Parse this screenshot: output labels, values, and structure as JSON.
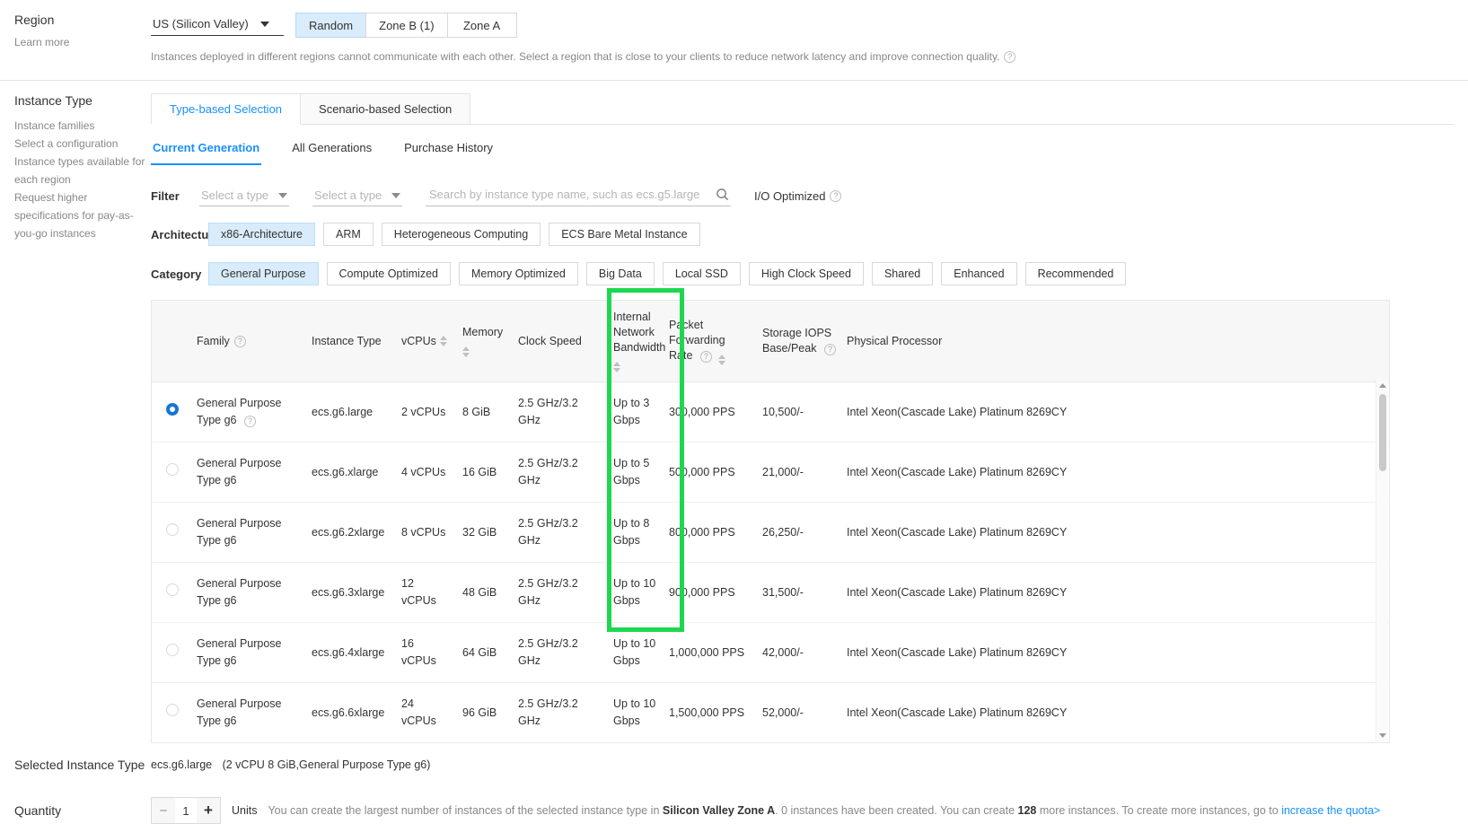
{
  "region": {
    "label": "Region",
    "learn_more": "Learn more",
    "selected": "US (Silicon Valley)",
    "zones": [
      {
        "label": "Random",
        "active": true
      },
      {
        "label": "Zone B (1)",
        "active": false
      },
      {
        "label": "Zone A",
        "active": false
      }
    ],
    "hint": "Instances deployed in different regions cannot communicate with each other. Select a region that is close to your clients to reduce network latency and improve connection quality."
  },
  "sidebar": {
    "title": "Instance Type",
    "links": [
      "Instance families",
      "Select a configuration",
      "Instance types available for each region",
      "Request higher specifications for pay-as-you-go instances"
    ]
  },
  "outer_tabs": [
    {
      "label": "Type-based Selection",
      "active": true
    },
    {
      "label": "Scenario-based Selection",
      "active": false
    }
  ],
  "inner_tabs": [
    {
      "label": "Current Generation",
      "active": true
    },
    {
      "label": "All Generations",
      "active": false
    },
    {
      "label": "Purchase History",
      "active": false
    }
  ],
  "filter": {
    "key": "Filter",
    "select_1": "Select a type",
    "select_2": "Select a type",
    "search_placeholder": "Search by instance type name, such as ecs.g5.large",
    "search_value": "",
    "io_optimized": "I/O Optimized"
  },
  "architecture": {
    "key": "Architecture",
    "options": [
      {
        "label": "x86-Architecture",
        "active": true
      },
      {
        "label": "ARM",
        "active": false
      },
      {
        "label": "Heterogeneous Computing",
        "active": false
      },
      {
        "label": "ECS Bare Metal Instance",
        "active": false
      }
    ]
  },
  "category": {
    "key": "Category",
    "options": [
      {
        "label": "General Purpose",
        "active": true
      },
      {
        "label": "Compute Optimized",
        "active": false
      },
      {
        "label": "Memory Optimized",
        "active": false
      },
      {
        "label": "Big Data",
        "active": false
      },
      {
        "label": "Local SSD",
        "active": false
      },
      {
        "label": "High Clock Speed",
        "active": false
      },
      {
        "label": "Shared",
        "active": false
      },
      {
        "label": "Enhanced",
        "active": false
      },
      {
        "label": "Recommended",
        "active": false
      }
    ]
  },
  "table": {
    "columns": [
      {
        "label": "Family",
        "help": true,
        "sort": false
      },
      {
        "label": "Instance Type",
        "help": false,
        "sort": false
      },
      {
        "label": "vCPUs",
        "help": false,
        "sort": true
      },
      {
        "label": "Memory",
        "help": false,
        "sort": true
      },
      {
        "label": "Clock Speed",
        "help": false,
        "sort": false
      },
      {
        "label": "Internal Network Bandwidth",
        "help": false,
        "sort": true
      },
      {
        "label": "Packet Forwarding Rate",
        "help": true,
        "sort": true
      },
      {
        "label": "Storage IOPS Base/Peak",
        "help": true,
        "sort": false
      },
      {
        "label": "Physical Processor",
        "help": false,
        "sort": false
      }
    ],
    "rows": [
      {
        "selected": true,
        "family": "General Purpose Type g6",
        "family_help": true,
        "instance_type": "ecs.g6.large",
        "vcpus": "2 vCPUs",
        "memory": "8 GiB",
        "clock": "2.5 GHz/3.2 GHz",
        "bandwidth": "Up to 3 Gbps",
        "pps": "300,000 PPS",
        "iops": "10,500/-",
        "processor": "Intel Xeon(Cascade Lake) Platinum 8269CY"
      },
      {
        "selected": false,
        "family": "General Purpose Type g6",
        "family_help": false,
        "instance_type": "ecs.g6.xlarge",
        "vcpus": "4 vCPUs",
        "memory": "16 GiB",
        "clock": "2.5 GHz/3.2 GHz",
        "bandwidth": "Up to 5 Gbps",
        "pps": "500,000 PPS",
        "iops": "21,000/-",
        "processor": "Intel Xeon(Cascade Lake) Platinum 8269CY"
      },
      {
        "selected": false,
        "family": "General Purpose Type g6",
        "family_help": false,
        "instance_type": "ecs.g6.2xlarge",
        "vcpus": "8 vCPUs",
        "memory": "32 GiB",
        "clock": "2.5 GHz/3.2 GHz",
        "bandwidth": "Up to 8 Gbps",
        "pps": "800,000 PPS",
        "iops": "26,250/-",
        "processor": "Intel Xeon(Cascade Lake) Platinum 8269CY"
      },
      {
        "selected": false,
        "family": "General Purpose Type g6",
        "family_help": false,
        "instance_type": "ecs.g6.3xlarge",
        "vcpus": "12 vCPUs",
        "memory": "48 GiB",
        "clock": "2.5 GHz/3.2 GHz",
        "bandwidth": "Up to 10 Gbps",
        "pps": "900,000 PPS",
        "iops": "31,500/-",
        "processor": "Intel Xeon(Cascade Lake) Platinum 8269CY"
      },
      {
        "selected": false,
        "family": "General Purpose Type g6",
        "family_help": false,
        "instance_type": "ecs.g6.4xlarge",
        "vcpus": "16 vCPUs",
        "memory": "64 GiB",
        "clock": "2.5 GHz/3.2 GHz",
        "bandwidth": "Up to 10 Gbps",
        "pps": "1,000,000 PPS",
        "iops": "42,000/-",
        "processor": "Intel Xeon(Cascade Lake) Platinum 8269CY"
      },
      {
        "selected": false,
        "family": "General Purpose Type g6",
        "family_help": false,
        "instance_type": "ecs.g6.6xlarge",
        "vcpus": "24 vCPUs",
        "memory": "96 GiB",
        "clock": "2.5 GHz/3.2 GHz",
        "bandwidth": "Up to 10 Gbps",
        "pps": "1,500,000 PPS",
        "iops": "52,000/-",
        "processor": "Intel Xeon(Cascade Lake) Platinum 8269CY"
      }
    ]
  },
  "selected_instance": {
    "label": "Selected Instance Type",
    "value": "ecs.g6.large",
    "detail": "(2 vCPU 8 GiB,General Purpose Type g6)"
  },
  "quantity": {
    "label": "Quantity",
    "minus": "−",
    "plus": "+",
    "value": "1",
    "units": "Units",
    "desc_1": "You can create the largest number of instances of the selected instance type in ",
    "zone": "Silicon Valley Zone A",
    "desc_2": ". 0 instances have been created. You can create ",
    "count": "128",
    "desc_3": " more instances. To create more instances, go to ",
    "link": "increase the quota>"
  },
  "colors": {
    "accent": "#1890ff",
    "chip_active_bg": "#d8ecfb",
    "annotation_green": "#1ed750",
    "radio_checked": "#1677d1"
  }
}
